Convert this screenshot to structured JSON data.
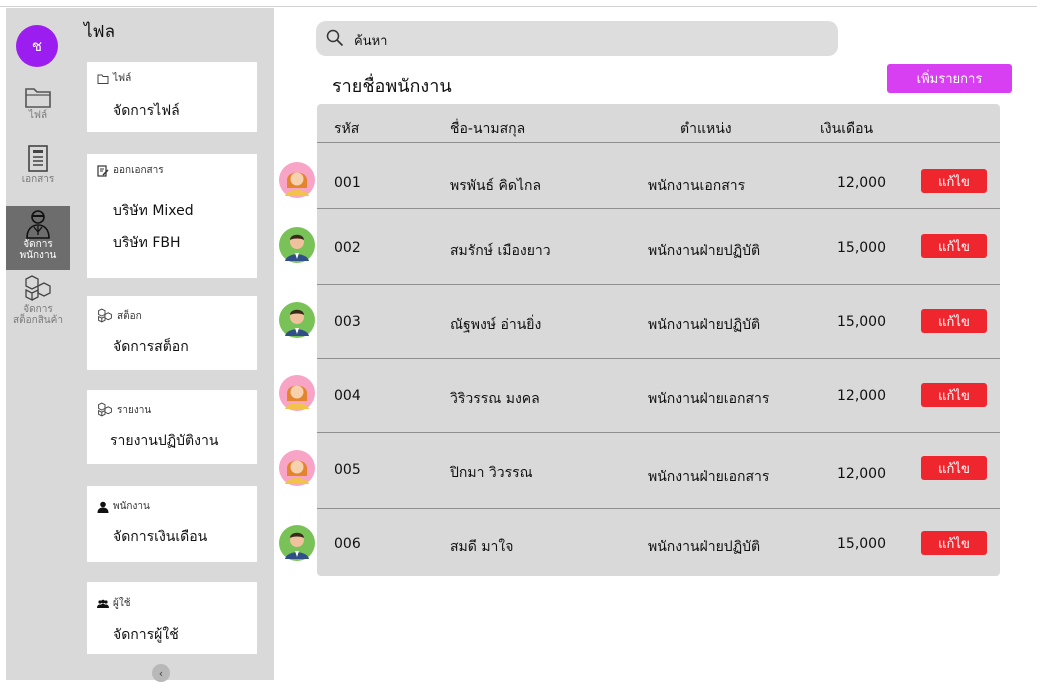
{
  "user_avatar_letter": "ช",
  "rail": [
    {
      "label": "ไฟล์",
      "icon": "folder-icon"
    },
    {
      "label": "เอกสาร",
      "icon": "document-icon"
    },
    {
      "label_line1": "จัดการ",
      "label_line2": "พนักงาน",
      "icon": "employee-icon",
      "active": true
    },
    {
      "label_line1": "จัดการ",
      "label_line2": "สต็อกสินค้า",
      "icon": "boxes-icon"
    }
  ],
  "menu": {
    "title": "ไฟล",
    "cards": [
      {
        "header": "ไฟล์",
        "icon": "folder-icon",
        "items": [
          "จัดการไฟล์"
        ]
      },
      {
        "header": "ออกเอกสาร",
        "icon": "edit-document-icon",
        "items": [
          "บริษัท Mixed",
          "บริษัท FBH"
        ]
      },
      {
        "header": "สต็อก",
        "icon": "boxes-icon",
        "items": [
          "จัดการสต็อก"
        ]
      },
      {
        "header": "รายงาน",
        "icon": "boxes-icon",
        "items": [
          "รายงานปฏิบัติงาน"
        ]
      },
      {
        "header": "พนักงาน",
        "icon": "person-icon",
        "items": [
          "จัดการเงินเดือน"
        ]
      },
      {
        "header": "ผู้ใช้",
        "icon": "group-icon",
        "items": [
          "จัดการผู้ใช้"
        ]
      }
    ],
    "collapse_glyph": "‹"
  },
  "search": {
    "placeholder": "ค้นหา"
  },
  "page_title": "รายชื่อพนักงาน",
  "add_button_label": "เพิ่มรายการ",
  "table": {
    "headers": [
      "รหัส",
      "ชื่อ-นามสกุล",
      "ตำแหน่ง",
      "เงินเดือน"
    ],
    "edit_label": "แก้ไข",
    "rows": [
      {
        "id": "001",
        "name": "พรพันธ์ คิดไกล",
        "position": "พนักงานเอกสาร",
        "salary": "12,000",
        "avatar": "female-avatar-icon"
      },
      {
        "id": "002",
        "name": "สมรักษ์ เมืองยาว",
        "position": "พนักงานฝ่ายปฏิบัติ",
        "salary": "15,000",
        "avatar": "male-avatar-icon"
      },
      {
        "id": "003",
        "name": "ณัฐพงษ์ อ่านยิ่ง",
        "position": "พนักงานฝ่ายปฏิบัติ",
        "salary": "15,000",
        "avatar": "male-avatar-icon"
      },
      {
        "id": "004",
        "name": "วิริวรรณ มงคล",
        "position": "พนักงานฝ่ายเอกสาร",
        "salary": "12,000",
        "avatar": "female-avatar-icon"
      },
      {
        "id": "005",
        "name": "ปิกมา วิวรรณ",
        "position": "พนักงานฝ่ายเอกสาร",
        "salary": "12,000",
        "avatar": "female-avatar-icon"
      },
      {
        "id": "006",
        "name": "สมดี มาใจ",
        "position": "พนักงานฝ่ายปฏิบัติ",
        "salary": "15,000",
        "avatar": "male-avatar-icon"
      }
    ]
  },
  "colors": {
    "accent": "#9b1df0",
    "add_button": "#d83ef2",
    "edit_button": "#f0262e",
    "panel": "#d9d9d9"
  }
}
